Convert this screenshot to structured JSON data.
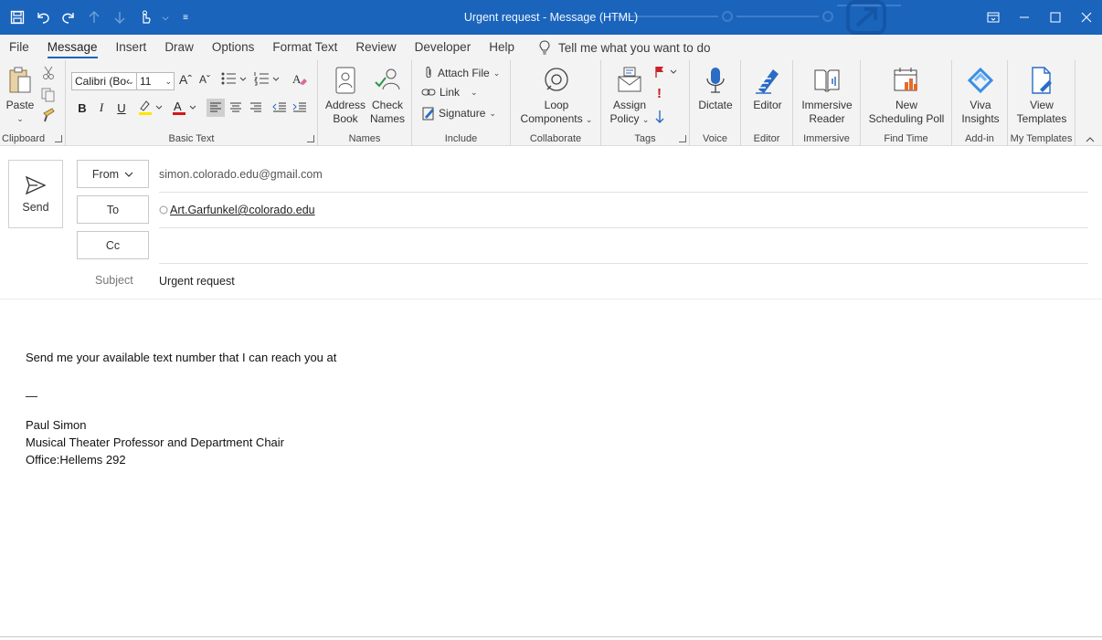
{
  "window": {
    "title": "Urgent request  -  Message (HTML)"
  },
  "menu": {
    "tabs": [
      "File",
      "Message",
      "Insert",
      "Draw",
      "Options",
      "Format Text",
      "Review",
      "Developer",
      "Help"
    ],
    "active_tab": "Message",
    "tell_me": "Tell me what you want to do"
  },
  "ribbon": {
    "clipboard": {
      "paste": "Paste",
      "label": "Clipboard"
    },
    "basic_text": {
      "font": "Calibri (Bo‹",
      "size": "11",
      "bold": "B",
      "italic": "I",
      "underline": "U",
      "label": "Basic Text"
    },
    "names": {
      "address_book_1": "Address",
      "address_book_2": "Book",
      "check_names_1": "Check",
      "check_names_2": "Names",
      "label": "Names"
    },
    "include": {
      "attach_file": "Attach File",
      "link": "Link",
      "signature": "Signature",
      "label": "Include"
    },
    "collaborate": {
      "loop_1": "Loop",
      "loop_2": "Components",
      "label": "Collaborate"
    },
    "tags": {
      "assign_1": "Assign",
      "assign_2": "Policy",
      "label": "Tags"
    },
    "voice": {
      "dictate": "Dictate",
      "label": "Voice"
    },
    "editor": {
      "editor": "Editor",
      "label": "Editor"
    },
    "immersive": {
      "reader_1": "Immersive",
      "reader_2": "Reader",
      "label": "Immersive"
    },
    "find_time": {
      "poll_1": "New",
      "poll_2": "Scheduling Poll",
      "label": "Find Time"
    },
    "addin": {
      "viva_1": "Viva",
      "viva_2": "Insights",
      "label": "Add-in"
    },
    "templates": {
      "view_1": "View",
      "view_2": "Templates",
      "label": "My Templates"
    }
  },
  "colors": {
    "accent": "#1a64bc",
    "ribbon_bg": "#f3f3f3"
  },
  "compose": {
    "send_label": "Send",
    "from_label": "From",
    "from_value": "simon.colorado.edu@gmail.com",
    "to_label": "To",
    "to_value": "Art.Garfunkel@colorado.edu",
    "cc_label": "Cc",
    "cc_value": "",
    "subject_label": "Subject",
    "subject_value": "Urgent request"
  },
  "body": {
    "line1": "Send me your available text number that I can reach you at",
    "separator": "—",
    "sig_name": "Paul Simon",
    "sig_title": "Musical Theater Professor and Department Chair",
    "sig_office": "Office:Hellems 292"
  }
}
